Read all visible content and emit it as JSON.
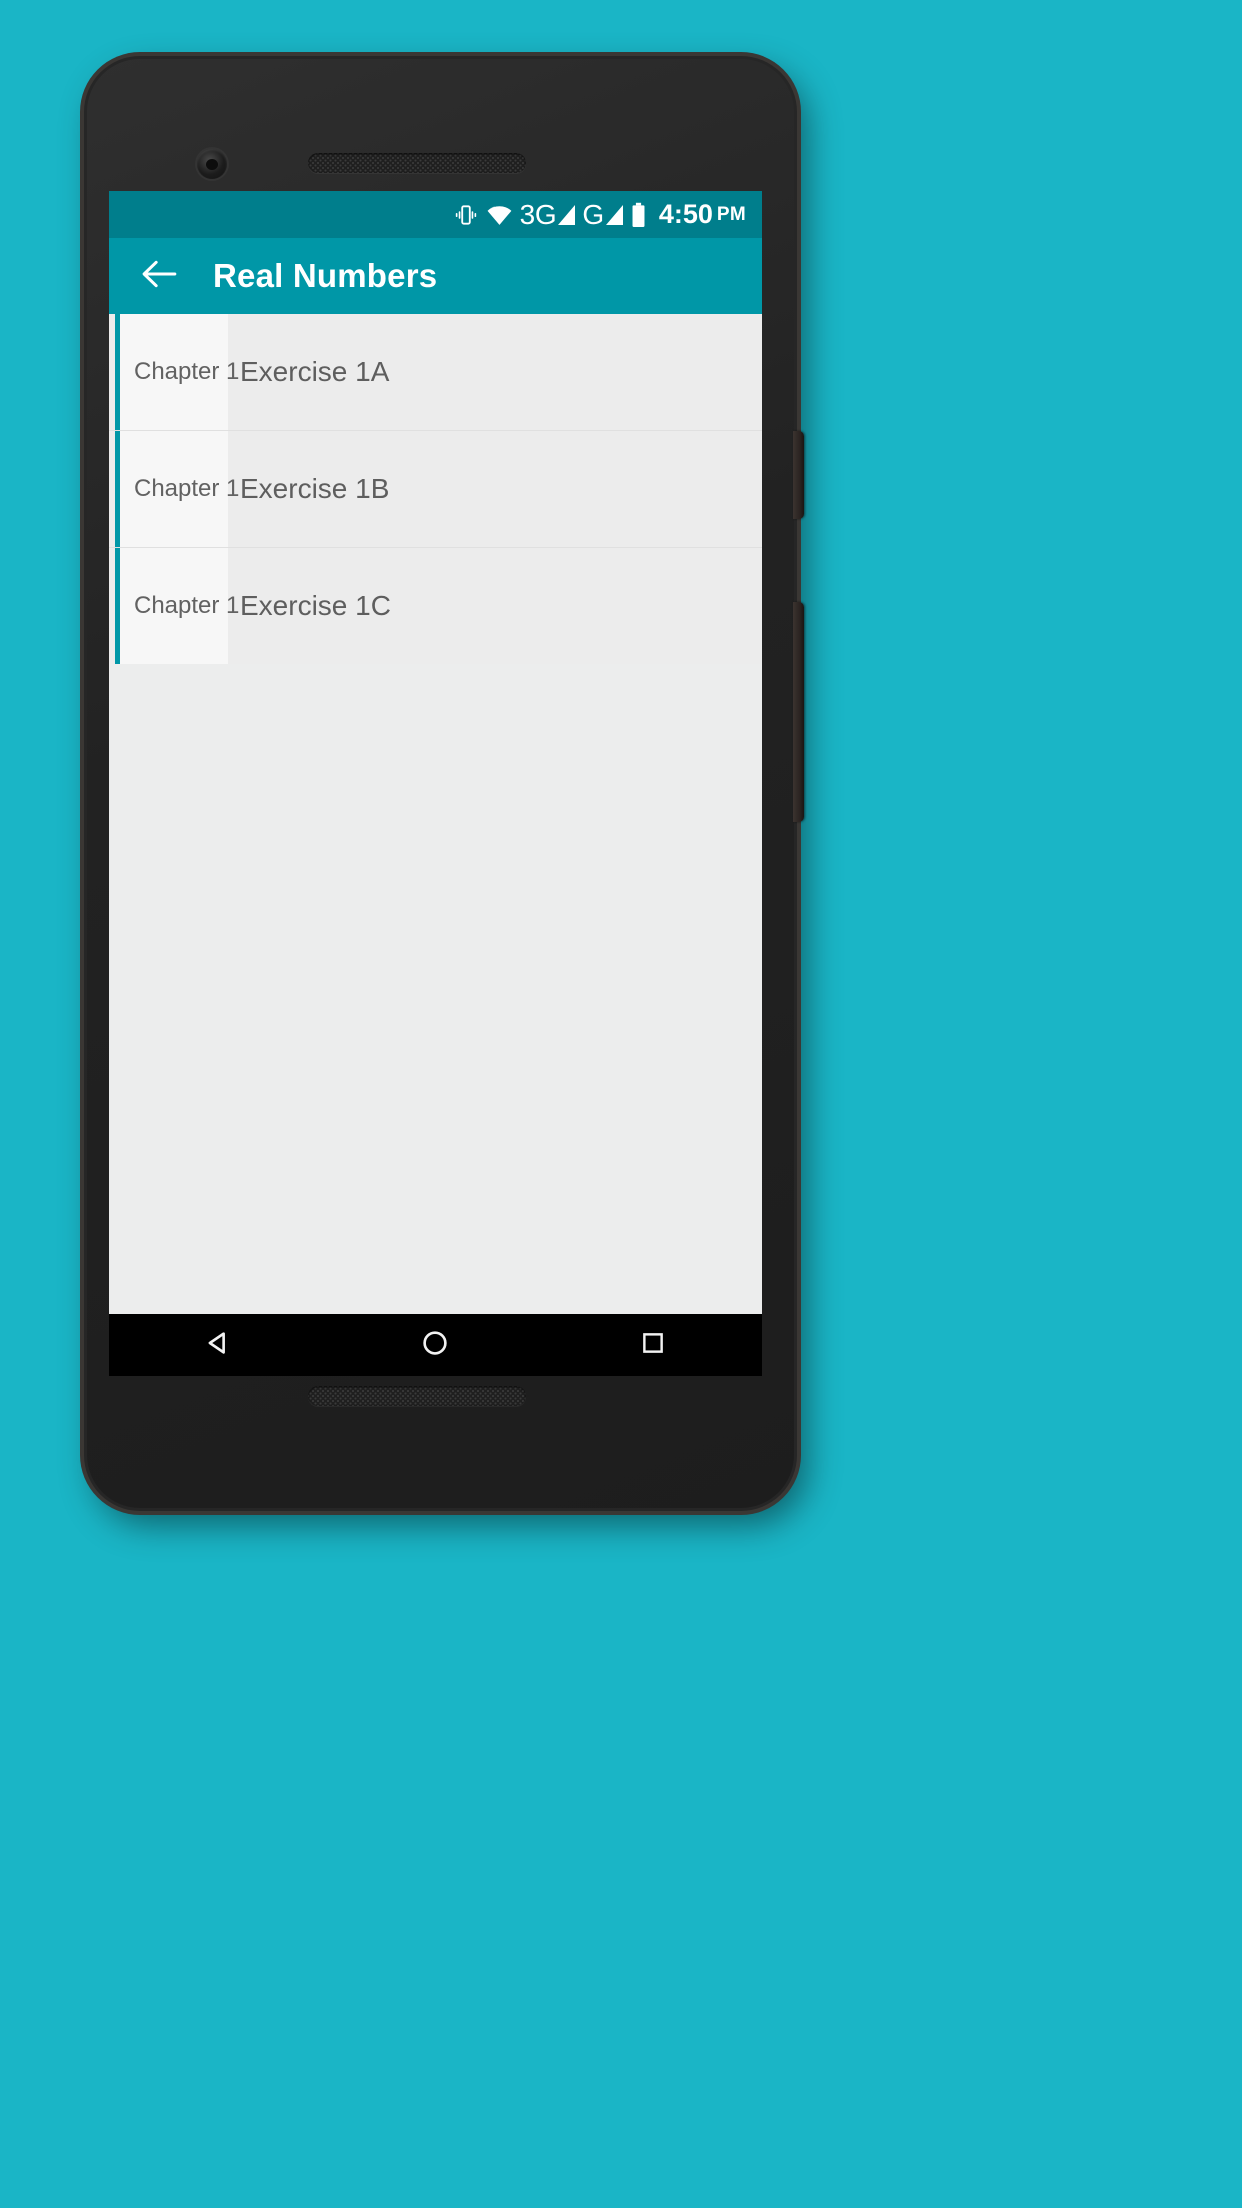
{
  "wallpaper": {
    "color": "#1ab5c6"
  },
  "device": {
    "body_color": "#262626",
    "camera_icon": "front-camera-icon",
    "earpiece_icon": "speaker-grille-icon",
    "bottom_speaker_icon": "speaker-grille-icon",
    "power_button_label": "Power",
    "volume_button_label": "Volume"
  },
  "status_bar": {
    "background": "#007e8c",
    "icons": [
      {
        "name": "vibrate-icon",
        "glyph": "vibrate"
      },
      {
        "name": "wifi-icon",
        "glyph": "wifi"
      }
    ],
    "network_1": {
      "label": "3G",
      "name": "signal-3g"
    },
    "network_2": {
      "label": "G",
      "name": "signal-g"
    },
    "battery": {
      "name": "battery-icon",
      "level": "full"
    },
    "time": "4:50",
    "meridiem": "PM"
  },
  "app_bar": {
    "background": "#0097a7",
    "back_icon": "arrow-back-icon",
    "title": "Real Numbers"
  },
  "list": {
    "background": "#eceded",
    "accent_color": "#0097a7",
    "rows": [
      {
        "chapter": "Chapter 1",
        "exercise": "Exercise 1A"
      },
      {
        "chapter": "Chapter 1",
        "exercise": "Exercise 1B"
      },
      {
        "chapter": "Chapter 1",
        "exercise": "Exercise 1C"
      }
    ]
  },
  "nav_bar": {
    "background": "#000000",
    "back_label": "Back",
    "home_label": "Home",
    "recents_label": "Recents"
  }
}
